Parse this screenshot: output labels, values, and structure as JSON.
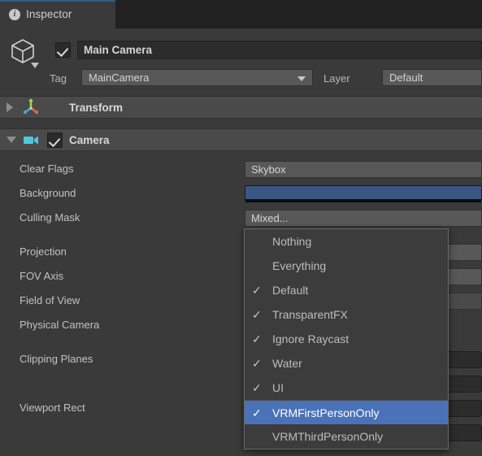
{
  "window": {
    "tab_label": "Inspector",
    "tab_icon": "info-icon",
    "accent_color": "#2C5D87"
  },
  "gameobject": {
    "icon": "cube-icon",
    "enabled": true,
    "name": "Main Camera",
    "tag_label": "Tag",
    "tag_value": "MainCamera",
    "layer_label": "Layer",
    "layer_value": "Default"
  },
  "components": [
    {
      "title": "Transform",
      "icon": "transform-gizmo-icon",
      "expanded": false,
      "has_enable_toggle": false
    },
    {
      "title": "Camera",
      "icon": "camera-icon",
      "expanded": true,
      "has_enable_toggle": true,
      "enabled": true
    }
  ],
  "camera_properties": [
    {
      "label": "Clear Flags",
      "value": "Skybox",
      "kind": "dropdown"
    },
    {
      "label": "Background",
      "value": "",
      "kind": "color",
      "color": "#3A5783"
    },
    {
      "label": "Culling Mask",
      "value": "Mixed...",
      "kind": "dropdown"
    },
    {
      "label": "Projection",
      "value": "",
      "kind": "dropdown"
    },
    {
      "label": "FOV Axis",
      "value": "",
      "kind": "dropdown"
    },
    {
      "label": "Field of View",
      "value": "",
      "kind": "slider"
    },
    {
      "label": "Physical Camera",
      "value": "",
      "kind": "toggle"
    },
    {
      "label": "Clipping Planes",
      "value": "",
      "kind": "group"
    },
    {
      "label": "Viewport Rect",
      "value": "",
      "kind": "group"
    }
  ],
  "culling_mask_menu": {
    "highlight_color": "#4A72B8",
    "check_glyph": "✓",
    "items": [
      {
        "label": "Nothing",
        "checked": false,
        "selected": false,
        "separator_above": false
      },
      {
        "label": "Everything",
        "checked": false,
        "selected": false,
        "separator_above": false
      },
      {
        "label": "Default",
        "checked": true,
        "selected": false,
        "separator_above": false
      },
      {
        "label": "TransparentFX",
        "checked": true,
        "selected": false,
        "separator_above": false
      },
      {
        "label": "Ignore Raycast",
        "checked": true,
        "selected": false,
        "separator_above": false
      },
      {
        "label": "Water",
        "checked": true,
        "selected": false,
        "separator_above": false
      },
      {
        "label": "UI",
        "checked": true,
        "selected": false,
        "separator_above": false
      },
      {
        "label": "VRMFirstPersonOnly",
        "checked": true,
        "selected": true,
        "separator_above": true
      },
      {
        "label": "VRMThirdPersonOnly",
        "checked": false,
        "selected": false,
        "separator_above": false
      }
    ]
  }
}
